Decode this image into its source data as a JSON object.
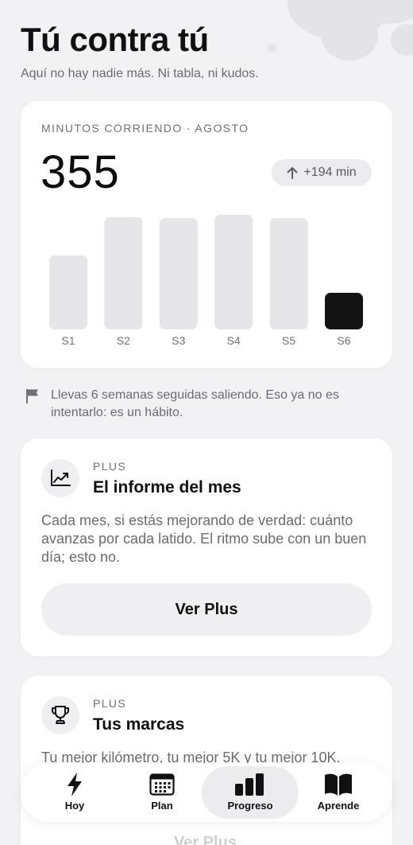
{
  "header": {
    "title": "Tú contra tú",
    "subtitle": "Aquí no hay nadie más. Ni tabla, ni kudos."
  },
  "summary_card": {
    "kicker": "MINUTOS CORRIENDO · AGOSTO",
    "total": "355",
    "delta": "+194 min",
    "colors": {
      "bar": "#e6e6e8",
      "current_bar": "#141414"
    }
  },
  "chart_data": {
    "type": "bar",
    "categories": [
      "S1",
      "S2",
      "S3",
      "S4",
      "S5",
      "S6"
    ],
    "values": [
      93,
      141,
      140,
      144,
      140,
      46
    ],
    "highlight_index": 5,
    "ylim": [
      0,
      144
    ],
    "grid": false,
    "title": "",
    "xlabel": "",
    "ylabel": ""
  },
  "streak": {
    "icon": "flag-icon",
    "text": "Llevas 6 semanas seguidas saliendo. Eso ya no es intentarlo: es un hábito."
  },
  "plus_cards": [
    {
      "icon": "chart-trend-icon",
      "kicker": "PLUS",
      "title": "El informe del mes",
      "body": "Cada mes, si estás mejorando de verdad: cuánto avanzas por cada latido. El ritmo sube con un buen día; esto no.",
      "button": "Ver Plus"
    },
    {
      "icon": "trophy-icon",
      "kicker": "PLUS",
      "title": "Tus marcas",
      "body": "Tu mejor kilómetro, tu mejor 5K y tu mejor 10K.",
      "button": "Ver Plus"
    }
  ],
  "tab_bar": {
    "active": "Progreso",
    "tabs": [
      {
        "label": "Hoy",
        "icon": "bolt-icon"
      },
      {
        "label": "Plan",
        "icon": "calendar-icon"
      },
      {
        "label": "Progreso",
        "icon": "bar-chart-icon"
      },
      {
        "label": "Aprende",
        "icon": "book-icon"
      }
    ]
  }
}
